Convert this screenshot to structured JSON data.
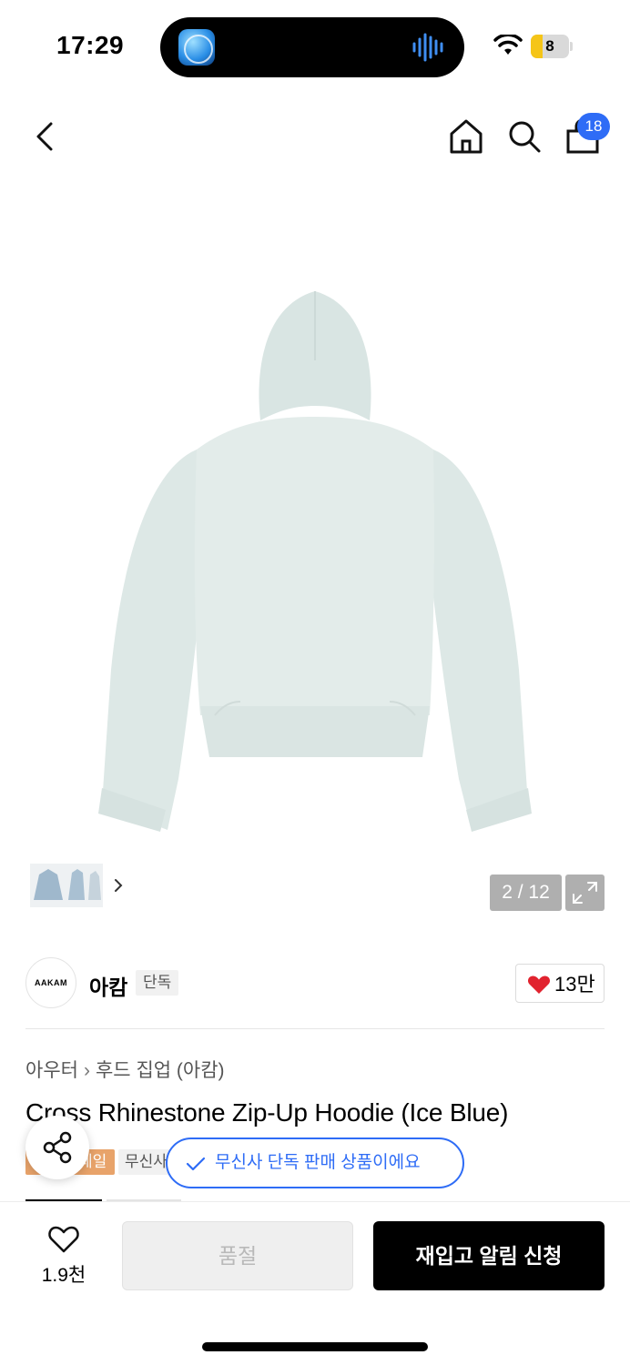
{
  "status_bar": {
    "time": "17:29",
    "battery_level": "8",
    "battery_fraction": 0.08,
    "battery_color": "#f5c518"
  },
  "top_nav": {
    "back_icon": "chevron-left-icon",
    "home_icon": "home-icon",
    "search_icon": "search-icon",
    "cart_icon": "shopping-bag-icon",
    "cart_count": "18",
    "badge_color": "#2e6cf6"
  },
  "gallery": {
    "current_page": "2 / 12",
    "expand_icon": "expand-icon"
  },
  "brand": {
    "logo_text": "AAKAM",
    "name": "아캄",
    "exclusive_label": "단독",
    "like_count": "13만"
  },
  "product": {
    "breadcrumb": [
      "아우터",
      "후드 집업 (아캄)"
    ],
    "title": "Cross Rhinestone Zip-Up Hoodie (Ice Blue)",
    "sale_tag": "세일",
    "musinsa_tag": "무신사",
    "exclusive_toast": "무신사 단독 판매 상품이에요"
  },
  "bottom_bar": {
    "wish_count": "1.9천",
    "soldout_label": "품절",
    "restock_label": "재입고 알림 신청"
  },
  "colors": {
    "accent_blue": "#2e6cf6",
    "sale_orange": "#e8a36a",
    "heart_red": "#e1232f",
    "hoodie_color": "#dfe9e7"
  }
}
